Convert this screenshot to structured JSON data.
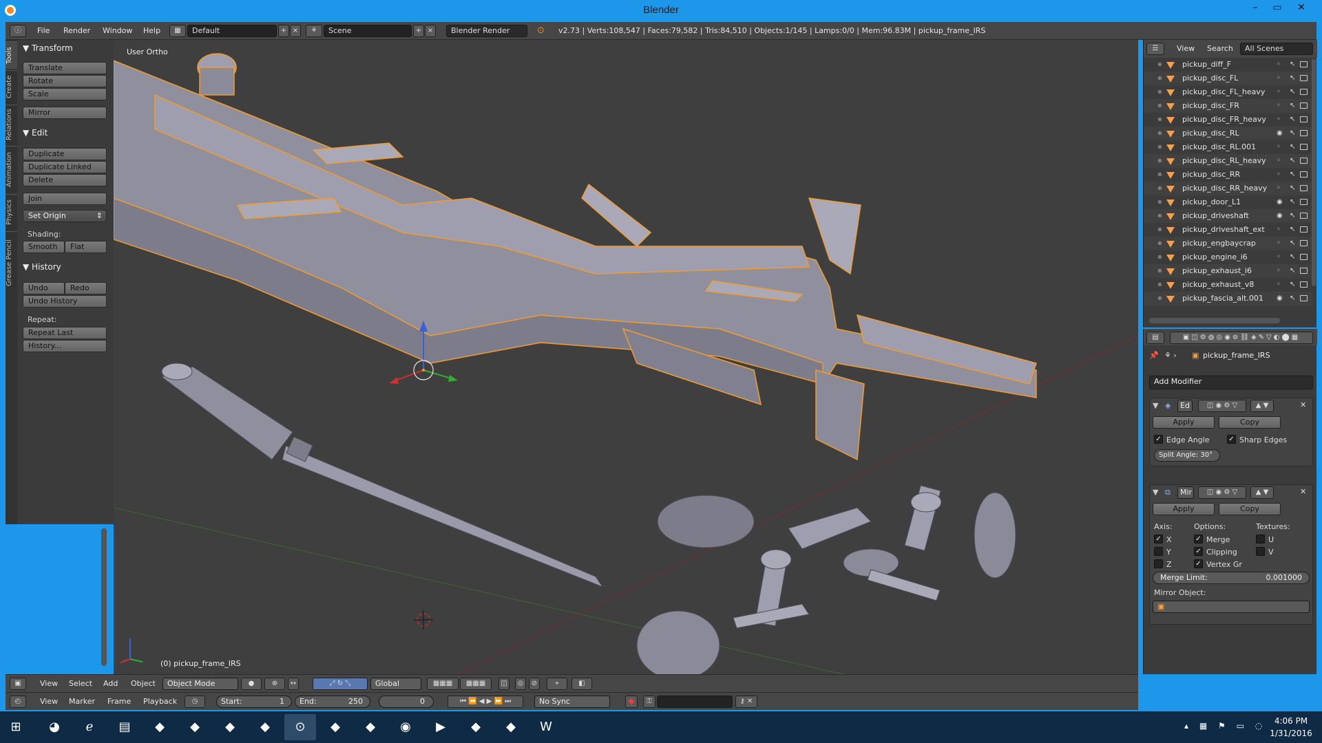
{
  "window": {
    "title": "Blender",
    "controls": {
      "minimize": "–",
      "maximize": "▭",
      "close": "✕"
    }
  },
  "info_header": {
    "menus": [
      "File",
      "Render",
      "Window",
      "Help"
    ],
    "layout": "Default",
    "scene": "Scene",
    "engine": "Blender Render",
    "stats": "v2.73 | Verts:108,547 | Faces:79,582 | Tris:84,510 | Objects:1/145 | Lamps:0/0 | Mem:96.83M | pickup_frame_IRS"
  },
  "tool_tabs": [
    "Tools",
    "Create",
    "Relations",
    "Animation",
    "Physics",
    "Grease Pencil"
  ],
  "tool_shelf": {
    "transform": {
      "title": "Transform",
      "buttons": [
        "Translate",
        "Rotate",
        "Scale",
        "Mirror"
      ]
    },
    "edit": {
      "title": "Edit",
      "buttons": [
        "Duplicate",
        "Duplicate Linked",
        "Delete",
        "Join"
      ],
      "set_origin": "Set Origin",
      "shading_label": "Shading:",
      "smooth": "Smooth",
      "flat": "Flat"
    },
    "history": {
      "title": "History",
      "undo": "Undo",
      "redo": "Redo",
      "undo_history": "Undo History",
      "repeat_label": "Repeat:",
      "repeat_last": "Repeat Last",
      "history": "History..."
    }
  },
  "viewport": {
    "view_name": "User Ortho",
    "object_label": "(0) pickup_frame_IRS",
    "colors": {
      "background": "#3f3f3f",
      "mesh": "#8f8f9e",
      "selection": "#f39c2e",
      "x_axis": "#a33232",
      "y_axis": "#3a7f2a"
    }
  },
  "view3d_header": {
    "menus": [
      "View",
      "Select",
      "Add",
      "Object"
    ],
    "mode": "Object Mode",
    "orientation": "Global"
  },
  "timeline": {
    "menus": [
      "View",
      "Marker",
      "Frame",
      "Playback"
    ],
    "start": "Start:",
    "start_value": "1",
    "end": "End:",
    "end_value": "250",
    "current": "0",
    "sync": "No Sync"
  },
  "outliner": {
    "menus": [
      "View",
      "Search"
    ],
    "scope": "All Scenes",
    "items": [
      {
        "name": "pickup_diff_F",
        "visible": false
      },
      {
        "name": "pickup_disc_FL",
        "visible": false
      },
      {
        "name": "pickup_disc_FL_heavy",
        "visible": false
      },
      {
        "name": "pickup_disc_FR",
        "visible": false
      },
      {
        "name": "pickup_disc_FR_heavy",
        "visible": false
      },
      {
        "name": "pickup_disc_RL",
        "visible": true
      },
      {
        "name": "pickup_disc_RL.001",
        "visible": false
      },
      {
        "name": "pickup_disc_RL_heavy",
        "visible": false
      },
      {
        "name": "pickup_disc_RR",
        "visible": false
      },
      {
        "name": "pickup_disc_RR_heavy",
        "visible": false
      },
      {
        "name": "pickup_door_L1",
        "visible": true
      },
      {
        "name": "pickup_driveshaft",
        "visible": true
      },
      {
        "name": "pickup_driveshaft_ext",
        "visible": false
      },
      {
        "name": "pickup_engbaycrap",
        "visible": false
      },
      {
        "name": "pickup_engine_i6",
        "visible": false
      },
      {
        "name": "pickup_exhaust_i6",
        "visible": false
      },
      {
        "name": "pickup_exhaust_v8",
        "visible": false
      },
      {
        "name": "pickup_fascia_alt.001",
        "visible": true
      }
    ]
  },
  "properties": {
    "object": "pickup_frame_IRS",
    "add_modifier": "Add Modifier",
    "edge_split": {
      "name": "Ed",
      "apply": "Apply",
      "copy": "Copy",
      "edge_angle": "Edge Angle",
      "sharp_edges": "Sharp Edges",
      "split_angle": "Split Angle: 30°"
    },
    "mirror": {
      "name": "Mir",
      "apply": "Apply",
      "copy": "Copy",
      "axis_label": "Axis:",
      "options_label": "Options:",
      "textures_label": "Textures:",
      "x": "X",
      "y": "Y",
      "z": "Z",
      "merge": "Merge",
      "clipping": "Clipping",
      "vertex_gr": "Vertex Gr",
      "u": "U",
      "v": "V",
      "merge_limit_label": "Merge Limit:",
      "merge_limit": "0.001000",
      "mirror_object_label": "Mirror Object:"
    }
  },
  "taskbar": {
    "apps": [
      "start",
      "chrome",
      "internet-explorer",
      "file-explorer",
      "app4",
      "app5",
      "app6",
      "app7",
      "blender",
      "app9",
      "app10",
      "steam",
      "media",
      "app13",
      "app14",
      "word"
    ],
    "time": "4:06 PM",
    "date": "1/31/2016"
  }
}
